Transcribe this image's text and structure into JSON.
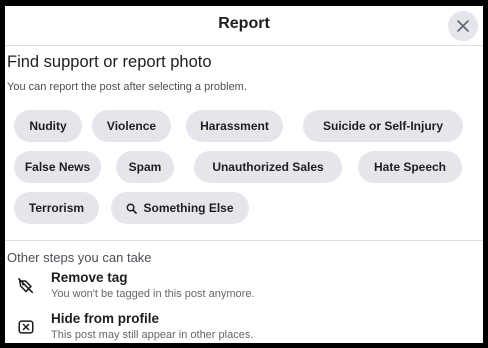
{
  "dialog": {
    "title": "Report",
    "close_icon": "close-icon"
  },
  "intro": {
    "heading": "Find support or report photo",
    "subheading": "You can report the post after selecting a problem."
  },
  "problems": {
    "row1": [
      "Nudity",
      "Violence",
      "Harassment",
      "Suicide or Self-Injury"
    ],
    "row2": [
      "False News",
      "Spam",
      "Unauthorized Sales",
      "Hate Speech"
    ],
    "row3": [
      "Terrorism",
      "Something Else"
    ],
    "something_else_icon": "search-icon"
  },
  "other_steps": {
    "title": "Other steps you can take",
    "options": [
      {
        "label": "Remove tag",
        "description": "You won't be tagged in this post anymore.",
        "icon": "tag-remove-icon"
      },
      {
        "label": "Hide from profile",
        "description": "This post may still appear in other places.",
        "icon": "hide-box-icon"
      }
    ]
  },
  "colors": {
    "chip_bg": "#e4e6eb",
    "text_primary": "#1c1e21",
    "text_secondary": "#65676b"
  }
}
